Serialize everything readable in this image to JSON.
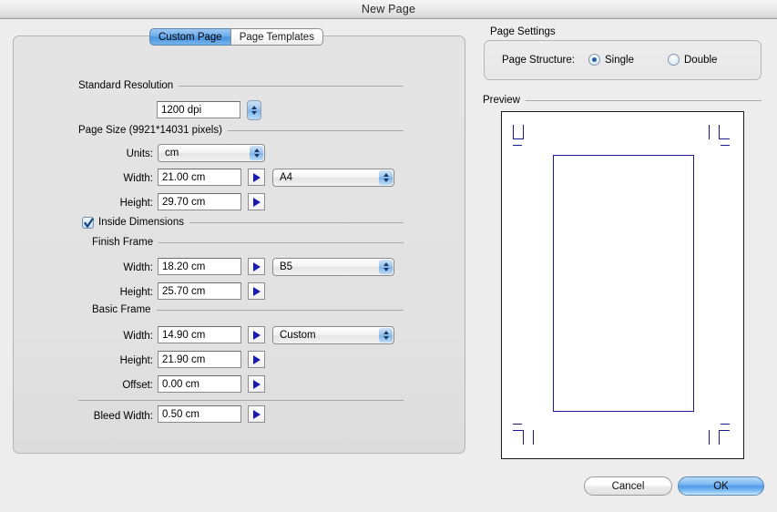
{
  "window": {
    "title": "New Page"
  },
  "tabs": [
    {
      "label": "Custom Page",
      "active": true
    },
    {
      "label": "Page Templates",
      "active": false
    }
  ],
  "custom_page": {
    "standard_resolution": {
      "group_label": "Standard Resolution",
      "value": "1200 dpi"
    },
    "page_size": {
      "group_label": "Page Size (9921*14031 pixels)",
      "units_label": "Units:",
      "units_value": "cm",
      "width_label": "Width:",
      "width_value": "21.00 cm",
      "width_preset": "A4",
      "height_label": "Height:",
      "height_value": "29.70 cm"
    },
    "inside_dimensions": {
      "label": "Inside Dimensions",
      "checked": true
    },
    "finish_frame": {
      "group_label": "Finish Frame",
      "width_label": "Width:",
      "width_value": "18.20 cm",
      "width_preset": "B5",
      "height_label": "Height:",
      "height_value": "25.70 cm"
    },
    "basic_frame": {
      "group_label": "Basic Frame",
      "width_label": "Width:",
      "width_value": "14.90 cm",
      "width_preset": "Custom",
      "height_label": "Height:",
      "height_value": "21.90 cm",
      "offset_label": "Offset:",
      "offset_value": "0.00 cm"
    },
    "bleed": {
      "label": "Bleed Width:",
      "value": "0.50 cm"
    }
  },
  "page_settings": {
    "title": "Page Settings",
    "page_structure_label": "Page Structure:",
    "options": [
      {
        "label": "Single",
        "selected": true
      },
      {
        "label": "Double",
        "selected": false
      }
    ]
  },
  "preview": {
    "title": "Preview"
  },
  "footer": {
    "cancel_label": "Cancel",
    "ok_label": "OK"
  },
  "colors": {
    "accent_blue": "#4b95e0",
    "mark_navy": "#1b1b8f",
    "window_bg": "#ededed"
  }
}
